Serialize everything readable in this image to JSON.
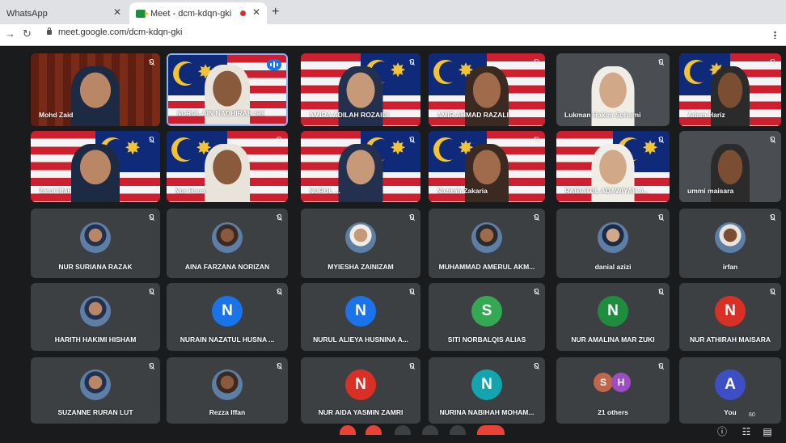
{
  "browser": {
    "tab1_title": "WhatsApp",
    "tab2_title": "Meet - dcm-kdqn-gki",
    "url": "meet.google.com/dcm-kdqn-gki"
  },
  "participants": [
    {
      "name": "Mohd Zaid",
      "type": "video"
    },
    {
      "name": "NURUL AIN NADHIRAH SHI...",
      "type": "video",
      "speaking": true
    },
    {
      "name": "AMIRA ADILAH ROZAIDI",
      "type": "video"
    },
    {
      "name": "AMIR AHMAD RAZALI",
      "type": "video"
    },
    {
      "name": "Lukman Hakim Suharni",
      "type": "video"
    },
    {
      "name": "Adam Hariz",
      "type": "video"
    },
    {
      "name": "Zatul Iffah",
      "type": "video"
    },
    {
      "name": "Nur Hana",
      "type": "video"
    },
    {
      "name": "NURUL ...",
      "type": "video"
    },
    {
      "name": "Nazirah Zakaria",
      "type": "video"
    },
    {
      "name": "RABIATUL ADAWIYAH A...",
      "type": "video"
    },
    {
      "name": "ummi maisara",
      "type": "video"
    },
    {
      "name": "NUR SURIANA RAZAK",
      "type": "photo"
    },
    {
      "name": "AINA FARZANA NORIZAN",
      "type": "photo"
    },
    {
      "name": "MYIESHA ZAINIZAM",
      "type": "photo"
    },
    {
      "name": "MUHAMMAD AMERUL AKM...",
      "type": "photo"
    },
    {
      "name": "danial azizi",
      "type": "photo"
    },
    {
      "name": "irfan",
      "type": "photo"
    },
    {
      "name": "HARITH HAKIMI HISHAM",
      "type": "photo"
    },
    {
      "name": "NURAIN NAZATUL HUSNA ...",
      "type": "letter",
      "initial": "N",
      "color": "#1a73e8"
    },
    {
      "name": "NURUL ALIEYA HUSNINA A...",
      "type": "letter",
      "initial": "N",
      "color": "#1a73e8"
    },
    {
      "name": "SITI NORBALQIS ALIAS",
      "type": "letter",
      "initial": "S",
      "color": "#34a853"
    },
    {
      "name": "NUR AMALINA MAR ZUKI",
      "type": "letter",
      "initial": "N",
      "color": "#1e8e3e"
    },
    {
      "name": "NUR ATHIRAH MAISARA",
      "type": "letter",
      "initial": "N",
      "color": "#d93025"
    },
    {
      "name": "SUZANNE RURAN LUT",
      "type": "photo"
    },
    {
      "name": "Rezza Iffan",
      "type": "photo"
    },
    {
      "name": "NUR AIDA YASMIN ZAMRI",
      "type": "letter",
      "initial": "N",
      "color": "#d93025"
    },
    {
      "name": "NURINA NABIHAH MOHAM...",
      "type": "letter",
      "initial": "N",
      "color": "#12a4af"
    },
    {
      "name": "21 others",
      "type": "others",
      "initials": [
        "S",
        "H"
      ],
      "colors": [
        "#c0674a",
        "#9c4dc4"
      ]
    },
    {
      "name": "You",
      "type": "letter",
      "initial": "A",
      "color": "#3c4fc4"
    }
  ],
  "footer": {
    "participant_count": "60"
  },
  "colors": {
    "tile_bg": "#3c4043",
    "active_border": "#8ab4f8",
    "flag_red": "#cc1f2f",
    "flag_blue": "#102a7a",
    "flag_yellow": "#f4c430"
  }
}
